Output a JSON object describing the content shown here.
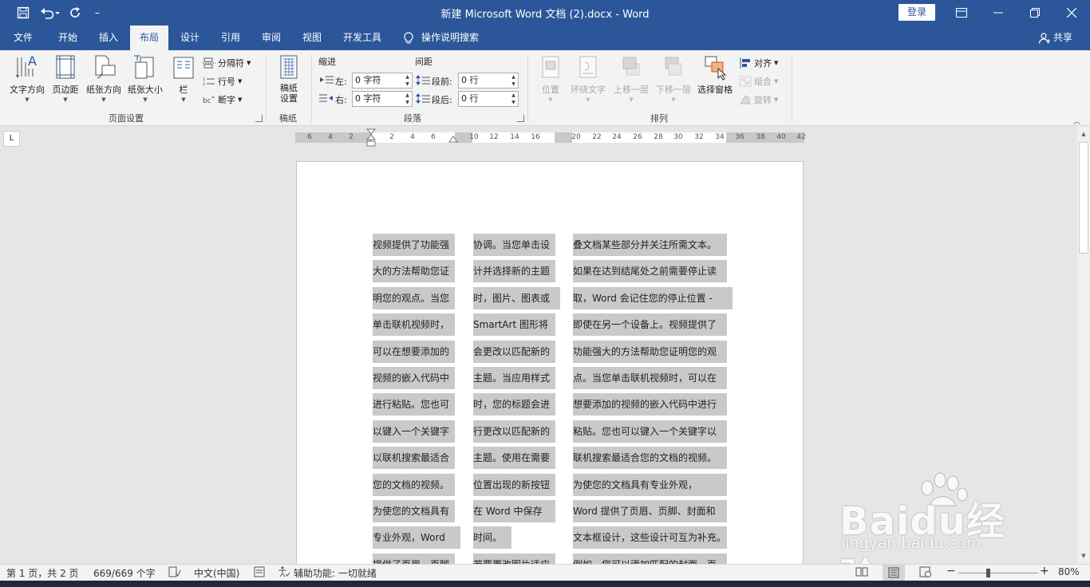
{
  "window": {
    "title": "新建 Microsoft Word 文档 (2).docx  -  Word",
    "login": "登录"
  },
  "tabs": [
    {
      "label": "文件"
    },
    {
      "label": "开始"
    },
    {
      "label": "插入"
    },
    {
      "label": "布局",
      "active": true
    },
    {
      "label": "设计"
    },
    {
      "label": "引用"
    },
    {
      "label": "审阅"
    },
    {
      "label": "视图"
    },
    {
      "label": "开发工具"
    }
  ],
  "tell_me": "操作说明搜索",
  "share": "共享",
  "ribbon": {
    "page_setup": {
      "label": "页面设置",
      "text_direction": "文字方向",
      "margins": "页边距",
      "orientation": "纸张方向",
      "size": "纸张大小",
      "columns": "栏",
      "breaks": "分隔符",
      "line_numbers": "行号",
      "hyphenation": "断字"
    },
    "draft": {
      "label": "稿纸",
      "draft_setup": "稿纸\n设置",
      "draft_line1": "稿纸",
      "draft_line2": "设置"
    },
    "paragraph": {
      "label": "段落",
      "indent": "缩进",
      "spacing": "间距",
      "left_label": "左:",
      "left_value": "0 字符",
      "right_label": "右:",
      "right_value": "0 字符",
      "before_label": "段前:",
      "before_value": "0 行",
      "after_label": "段后:",
      "after_value": "0 行"
    },
    "arrange": {
      "label": "排列",
      "position": "位置",
      "wrap_text": "环绕文字",
      "bring_forward": "上移一层",
      "send_backward": "下移一层",
      "selection_pane": "选择窗格",
      "align": "对齐",
      "group": "组合",
      "rotate": "旋转"
    }
  },
  "ruler": {
    "labels": [
      "6",
      "4",
      "2",
      "2",
      "4",
      "6",
      "10",
      "12",
      "14",
      "16",
      "20",
      "22",
      "24",
      "26",
      "28",
      "30",
      "32",
      "34",
      "36",
      "38",
      "40",
      "42"
    ]
  },
  "document": {
    "col1": [
      "视频提供了功能强",
      "大的方法帮助您证",
      "明您的观点。当您",
      "单击联机视频时，",
      "可以在想要添加的",
      "视频的嵌入代码中",
      "进行粘贴。您也可",
      "以键入一个关键字",
      "以联机搜索最适合",
      "您的文档的视频。",
      "为使您的文档具有",
      "专业外观，Word",
      "提供了页眉、页脚、"
    ],
    "col2": [
      "协调。当您单击设",
      "计并选择新的主题",
      "时，图片、图表或",
      "SmartArt 图形将",
      "会更改以匹配新的",
      "主题。当应用样式",
      "时，您的标题会进",
      "行更改以匹配新的",
      "主题。使用在需要",
      "位置出现的新按钮",
      "在  Word  中保存",
      "时间。",
      "若要更改图片适应"
    ],
    "col3": [
      "叠文档某些部分并关注所需文本。",
      "如果在达到结尾处之前需要停止读",
      "取，Word 会记住您的停止位置 -",
      "即使在另一个设备上。视频提供了",
      "功能强大的方法帮助您证明您的观",
      "点。当您单击联机视频时，可以在",
      "想要添加的视频的嵌入代码中进行",
      "粘贴。您也可以键入一个关键字以",
      "联机搜索最适合您的文档的视频。",
      "为使您的文档具有专业外观，",
      "Word 提供了页眉、页脚、封面和",
      "文本框设计，这些设计可互为补充。",
      "例如，您可以添加匹配的封面、页"
    ]
  },
  "status": {
    "page": "第 1 页，共 2 页",
    "words": "669/669 个字",
    "language": "中文(中国)",
    "accessibility": "辅助功能: 一切就绪",
    "zoom": "80%"
  },
  "watermark": {
    "brand": "Baidu经验",
    "url": "jingyan.baidu.com"
  },
  "colors": {
    "accent": "#2b579a",
    "selection": "#c9c9c9"
  }
}
